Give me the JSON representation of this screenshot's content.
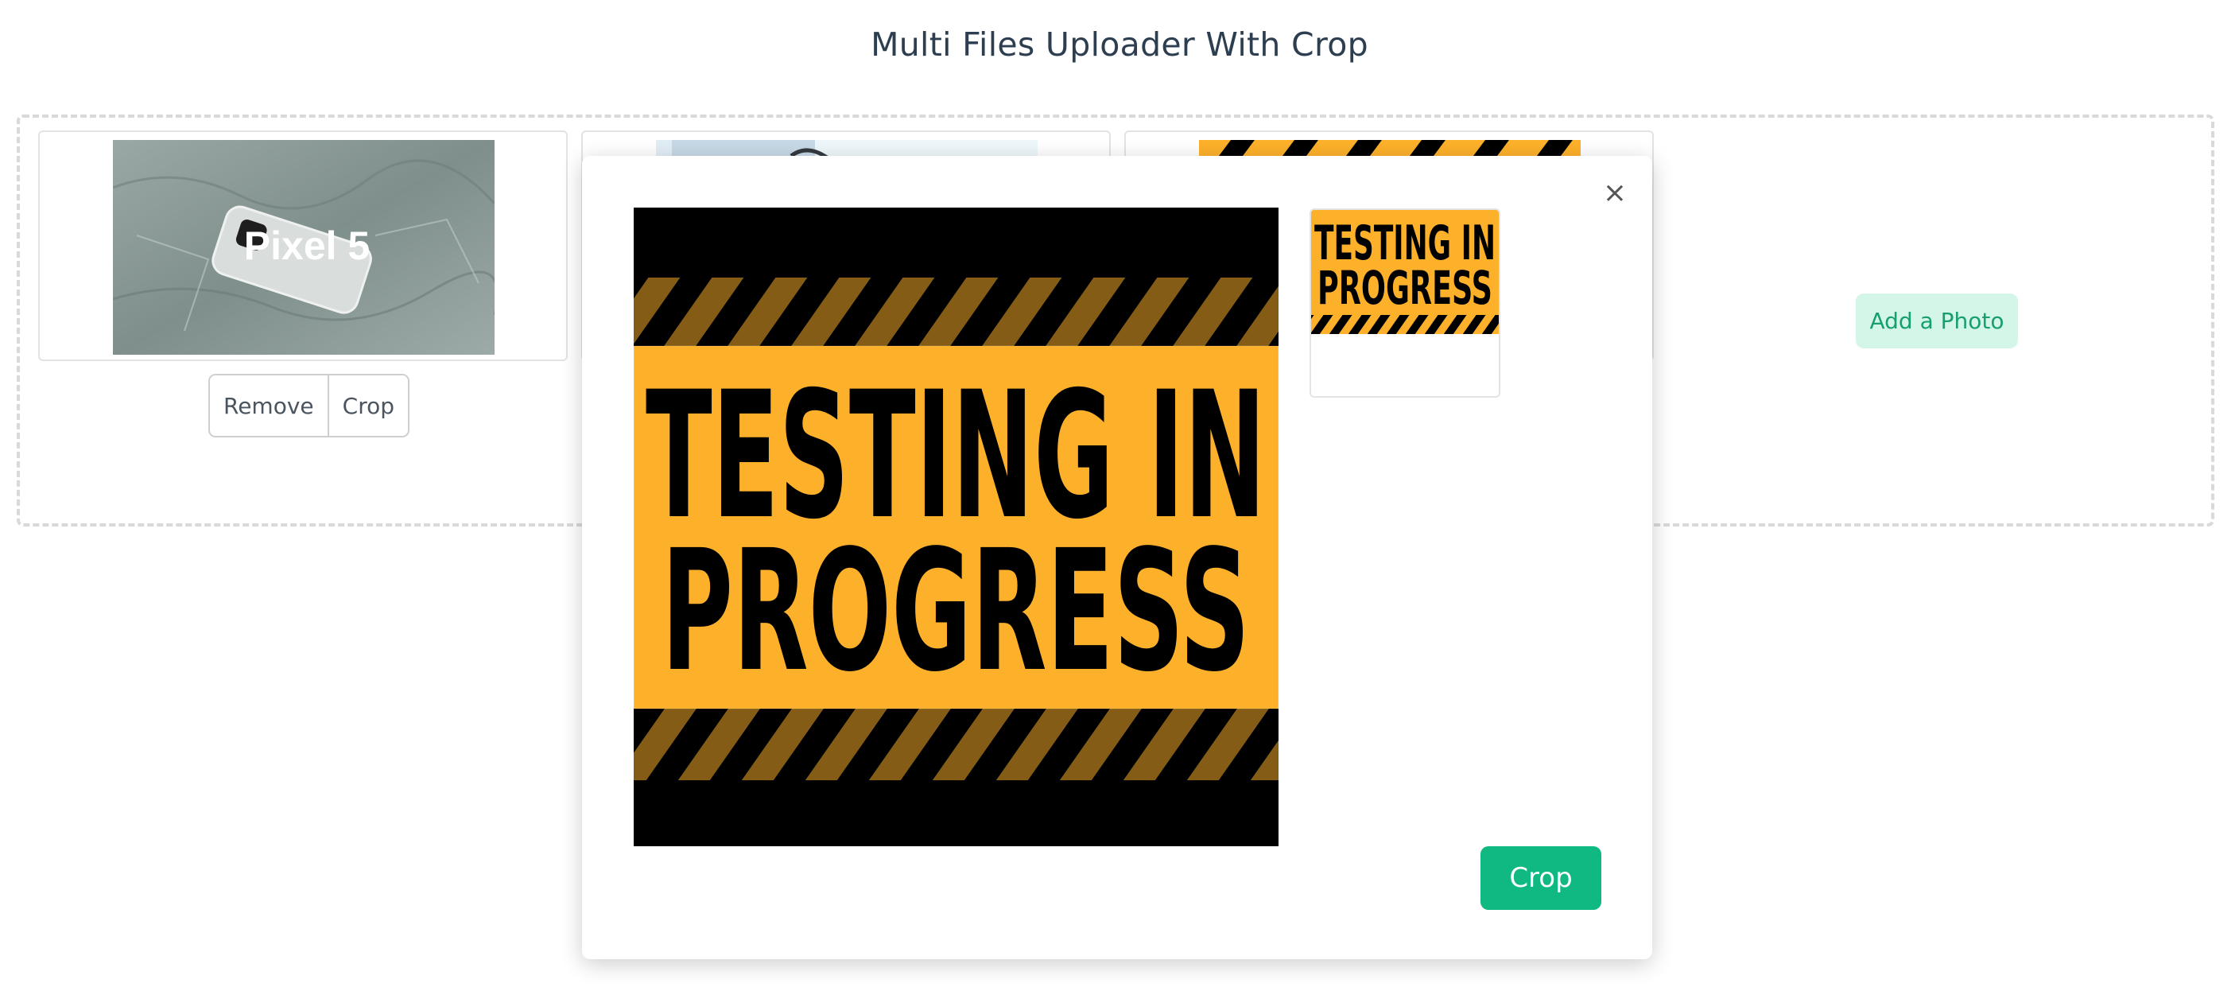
{
  "header": {
    "title": "Multi Files Uploader With Crop"
  },
  "uploader": {
    "items": [
      {
        "thumb_text": "Pixel 5",
        "remove_label": "Remove",
        "crop_label": "Crop"
      }
    ],
    "add_photo_label": "Add a Photo"
  },
  "crop_modal": {
    "close_icon": "×",
    "sign_line1": "TESTING IN",
    "sign_line2": "PROGRESS",
    "crop_button_label": "Crop"
  },
  "colors": {
    "accent": "#10b981",
    "add_photo_bg": "#d4f6e8",
    "sign_yellow": "#fdb12b"
  }
}
